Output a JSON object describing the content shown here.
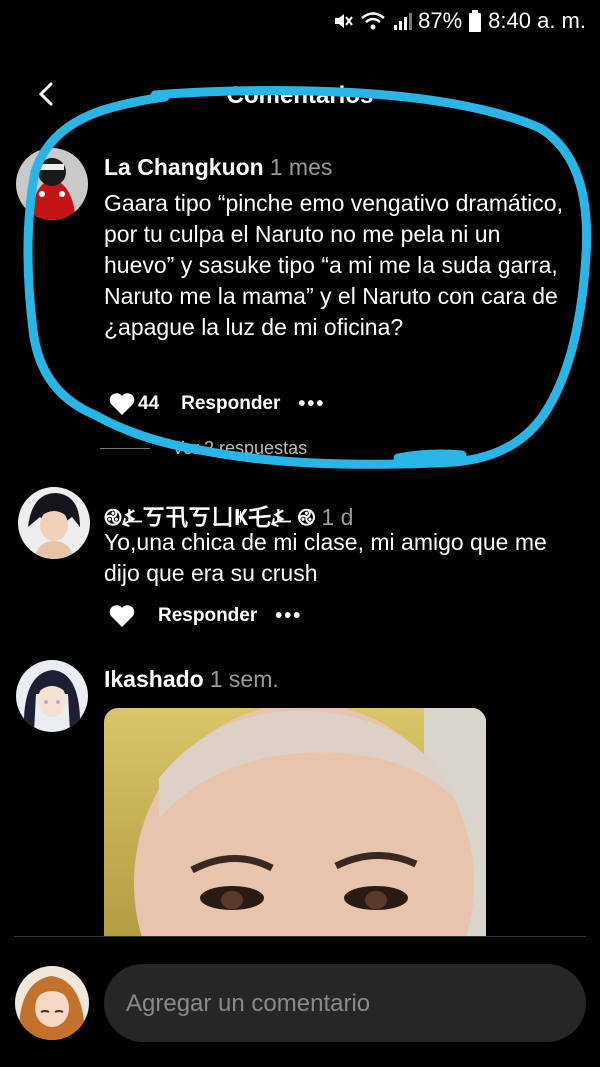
{
  "status_bar": {
    "battery": "87%",
    "time": "8:40 a. m."
  },
  "header": {
    "title": "Comentarios"
  },
  "comments": [
    {
      "author": "La Changkuon",
      "time": "1 mes",
      "text": "Gaara tipo “pinche emo vengativo dramático, por tu culpa el Naruto no me pela ni un huevo” y sasuke tipo “a mi me la suda garra, Naruto me la mama” y el Naruto con cara de ¿apague la luz de mi oficina?",
      "likes": "44",
      "reply_label": "Responder",
      "replies_label": "Ver 2 respuestas"
    },
    {
      "author": "࿋⍼ㄎ卂ㄎㄩҜ乇⍼ ࿋",
      "time": "1 d",
      "text": "Yo,una chica de mi clase, mi amigo que me dijo que era su crush",
      "reply_label": "Responder"
    },
    {
      "author": "Ikashado",
      "time": "1 sem."
    }
  ],
  "composer": {
    "placeholder": "Agregar un comentario"
  },
  "colors": {
    "background": "#000000",
    "highlight": "#29b6e6",
    "muted": "#9a9a9a",
    "input_bg": "#262628"
  }
}
